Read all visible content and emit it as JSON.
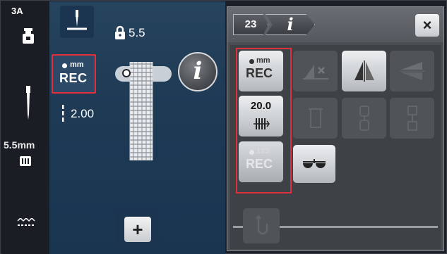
{
  "sidebar": {
    "presser_foot_code": "3A",
    "stitch_width": "5.5mm"
  },
  "main": {
    "lock_value": "5.5",
    "rec_mm_label": "mm",
    "rec_label": "REC",
    "stitch_length": "2.00",
    "info_label": "i",
    "plus_label": "+"
  },
  "panel": {
    "breadcrumb_number": "23",
    "breadcrumb_info": "i",
    "close_label": "×",
    "rec_mm_tile": {
      "unit": "mm",
      "label": "REC"
    },
    "length_tile": {
      "value": "20.0"
    },
    "rec_count_tile": {
      "unit": "123",
      "label": "REC"
    }
  }
}
